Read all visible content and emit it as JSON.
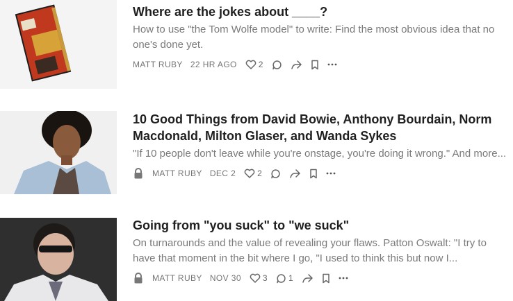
{
  "posts": [
    {
      "title": "Where are the jokes about ____?",
      "subtitle": "How to use \"the Tom Wolfe model\" to write: Find the most obvious idea that no one's done yet.",
      "author": "MATT RUBY",
      "date": "22 HR AGO",
      "likes": "2",
      "comments": "",
      "locked": false,
      "thumbnail_icon": "book-cover-image"
    },
    {
      "title": "10 Good Things from David Bowie, Anthony Bourdain, Norm Macdonald, Milton Glaser, and Wanda Sykes",
      "subtitle": "\"If 10 people don't leave while you're onstage, you're doing it wrong.\" And more...",
      "author": "MATT RUBY",
      "date": "DEC 2",
      "likes": "2",
      "comments": "",
      "locked": true,
      "thumbnail_icon": "portrait-image"
    },
    {
      "title": "Going from \"you suck\" to \"we suck\"",
      "subtitle": "On turnarounds and the value of revealing your flaws. Patton Oswalt: \"I try to have that moment in the bit where I go, \"I used to think this but now I...",
      "author": "MATT RUBY",
      "date": "NOV 30",
      "likes": "3",
      "comments": "1",
      "locked": true,
      "thumbnail_icon": "portrait-image"
    }
  ],
  "colors": {
    "title": "#1f1f1f",
    "subtitle": "#7a7a7a",
    "meta": "#757575"
  }
}
